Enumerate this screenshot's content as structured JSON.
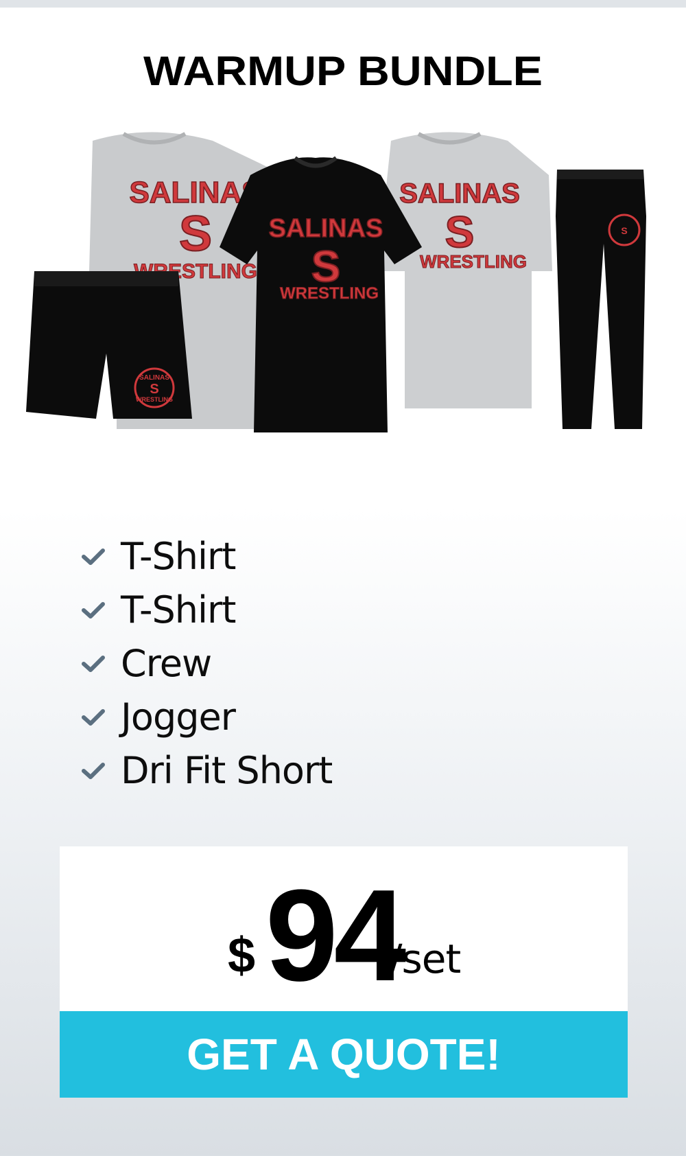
{
  "title": "WARMUP BUNDLE",
  "product_image": {
    "description_icon": "apparel-bundle-image",
    "shirt_text": {
      "line1": "SALINAS",
      "letter": "S",
      "line2": "WRESTLING"
    },
    "patch_text": {
      "line1": "SALINAS",
      "letter": "S",
      "line2": "WRESTLING"
    }
  },
  "features": [
    {
      "label": "T-Shirt",
      "icon": "check-icon"
    },
    {
      "label": "T-Shirt",
      "icon": "check-icon"
    },
    {
      "label": "Crew",
      "icon": "check-icon"
    },
    {
      "label": "Jogger",
      "icon": "check-icon"
    },
    {
      "label": "Dri Fit Short",
      "icon": "check-icon"
    }
  ],
  "price": {
    "currency": "$",
    "amount": "94",
    "unit": "/set"
  },
  "cta": {
    "label": "GET A QUOTE!"
  },
  "colors": {
    "accent": "#22bfde",
    "check": "#5b6f80",
    "logo_red": "#d0393c",
    "crew_gray": "#c9cbcd",
    "garment_black": "#0c0c0c"
  }
}
